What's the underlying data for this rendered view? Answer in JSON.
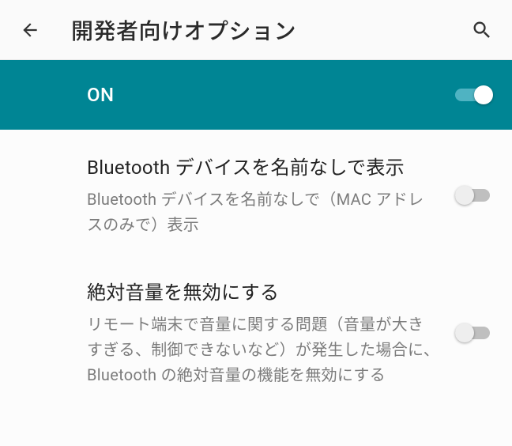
{
  "appbar": {
    "title": "開発者向けオプション"
  },
  "masterToggle": {
    "label": "ON",
    "state": "on"
  },
  "settings": [
    {
      "title": "Bluetooth デバイスを名前なしで表示",
      "desc": "Bluetooth デバイスを名前なしで（MAC アドレスのみで）表示",
      "state": "off"
    },
    {
      "title": "絶対音量を無効にする",
      "desc": "リモート端末で音量に関する問題（音量が大きすぎる、制御できないなど）が発生した場合に、Bluetooth の絶対音量の機能を無効にする",
      "state": "off"
    }
  ]
}
